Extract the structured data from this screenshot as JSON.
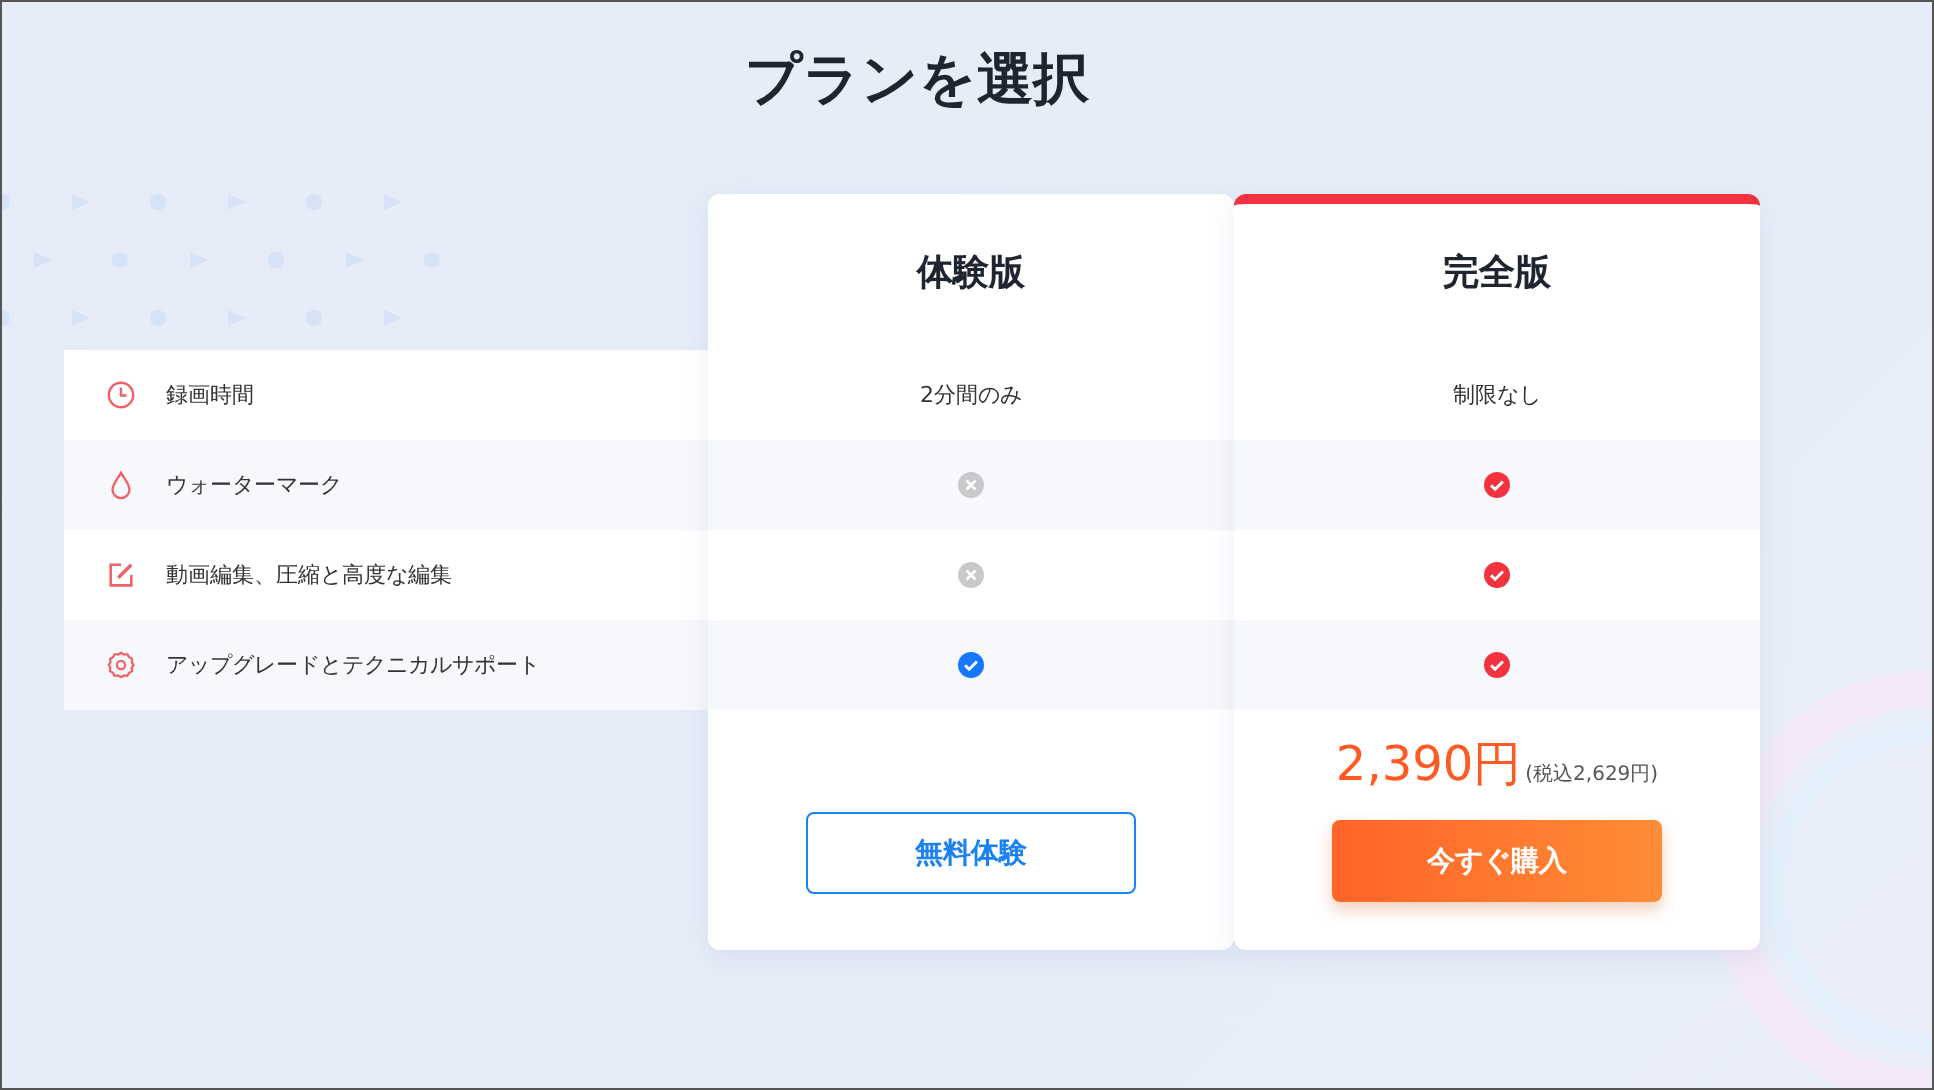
{
  "title": "プランを選択",
  "features": [
    "録画時間",
    "ウォーターマーク",
    "動画編集、圧縮と高度な編集",
    "アップグレードとテクニカルサポート"
  ],
  "plans": [
    {
      "name": "体験版",
      "featured": false,
      "cells": [
        {
          "kind": "text",
          "text": "2分間のみ"
        },
        {
          "kind": "no"
        },
        {
          "kind": "no"
        },
        {
          "kind": "yes"
        }
      ],
      "button": {
        "kind": "outline",
        "label": "無料体験"
      }
    },
    {
      "name": "完全版",
      "featured": true,
      "cells": [
        {
          "kind": "text",
          "text": "制限なし"
        },
        {
          "kind": "yes"
        },
        {
          "kind": "yes"
        },
        {
          "kind": "yes"
        }
      ],
      "price": "2,390円",
      "tax_note": "(税込2,629円)",
      "button": {
        "kind": "solid",
        "label": "今すぐ購入"
      }
    }
  ]
}
